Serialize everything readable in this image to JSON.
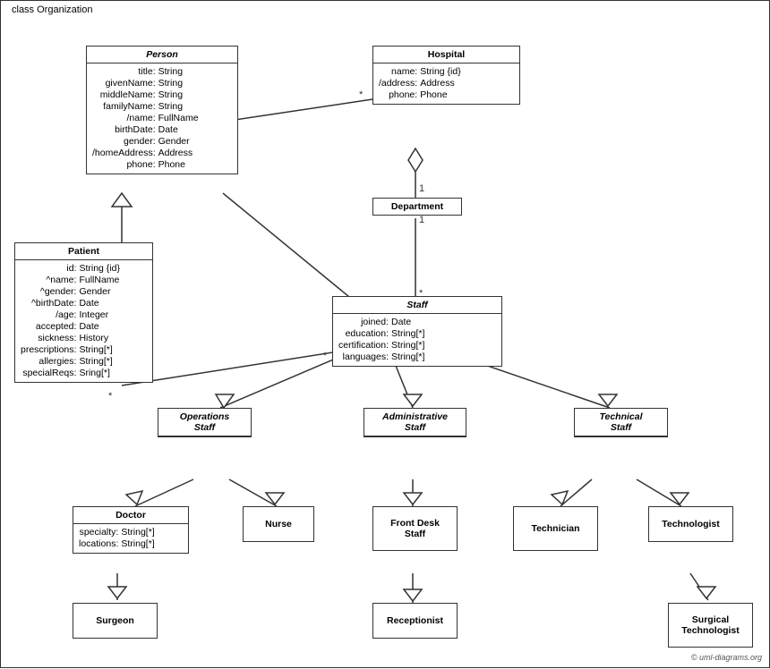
{
  "diagram": {
    "title": "class Organization",
    "classes": {
      "person": {
        "name": "Person",
        "italic": true,
        "attrs": [
          [
            "title:",
            "String"
          ],
          [
            "givenName:",
            "String"
          ],
          [
            "middleName:",
            "String"
          ],
          [
            "familyName:",
            "String"
          ],
          [
            "/name:",
            "FullName"
          ],
          [
            "birthDate:",
            "Date"
          ],
          [
            "gender:",
            "Gender"
          ],
          [
            "/homeAddress:",
            "Address"
          ],
          [
            "phone:",
            "Phone"
          ]
        ]
      },
      "hospital": {
        "name": "Hospital",
        "italic": false,
        "attrs": [
          [
            "name:",
            "String {id}"
          ],
          [
            "/address:",
            "Address"
          ],
          [
            "phone:",
            "Phone"
          ]
        ]
      },
      "patient": {
        "name": "Patient",
        "italic": false,
        "attrs": [
          [
            "id:",
            "String {id}"
          ],
          [
            "^name:",
            "FullName"
          ],
          [
            "^gender:",
            "Gender"
          ],
          [
            "^birthDate:",
            "Date"
          ],
          [
            "/age:",
            "Integer"
          ],
          [
            "accepted:",
            "Date"
          ],
          [
            "sickness:",
            "History"
          ],
          [
            "prescriptions:",
            "String[*]"
          ],
          [
            "allergies:",
            "String[*]"
          ],
          [
            "specialReqs:",
            "Sring[*]"
          ]
        ]
      },
      "department": {
        "name": "Department",
        "italic": false,
        "attrs": []
      },
      "staff": {
        "name": "Staff",
        "italic": true,
        "attrs": [
          [
            "joined:",
            "Date"
          ],
          [
            "education:",
            "String[*]"
          ],
          [
            "certification:",
            "String[*]"
          ],
          [
            "languages:",
            "String[*]"
          ]
        ]
      },
      "operations_staff": {
        "name": "Operations Staff",
        "italic": true
      },
      "administrative_staff": {
        "name": "Administrative Staff",
        "italic": true
      },
      "technical_staff": {
        "name": "Technical Staff",
        "italic": true
      },
      "doctor": {
        "name": "Doctor",
        "attrs": [
          [
            "specialty:",
            "String[*]"
          ],
          [
            "locations:",
            "String[*]"
          ]
        ]
      },
      "nurse": {
        "name": "Nurse"
      },
      "front_desk_staff": {
        "name": "Front Desk Staff"
      },
      "technician": {
        "name": "Technician"
      },
      "technologist": {
        "name": "Technologist"
      },
      "surgeon": {
        "name": "Surgeon"
      },
      "receptionist": {
        "name": "Receptionist"
      },
      "surgical_technologist": {
        "name": "Surgical Technologist"
      }
    },
    "copyright": "© uml-diagrams.org"
  }
}
